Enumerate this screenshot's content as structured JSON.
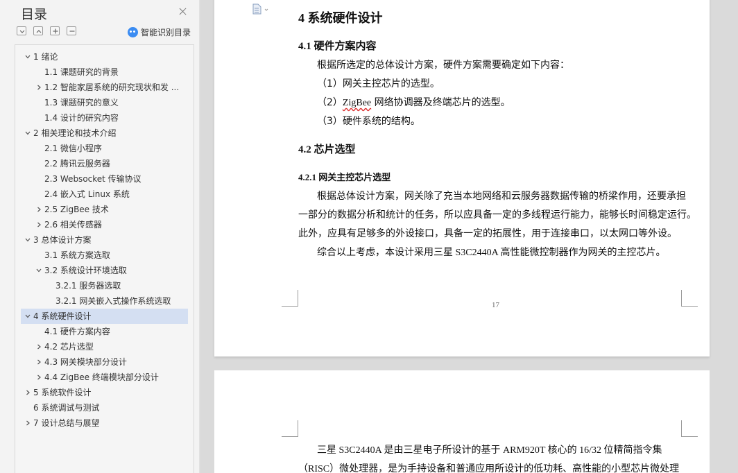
{
  "nav": {
    "title": "目录",
    "smart_toc_label": "智能识别目录",
    "items": [
      {
        "label": "1  绪论",
        "expandable": true,
        "expanded": true
      },
      {
        "label": "1.1  课题研究的背景",
        "expandable": false
      },
      {
        "label": "1.2  智能家居系统的研究现状和发 ...",
        "expandable": true,
        "expanded": false
      },
      {
        "label": "1.3  课题研究的意义",
        "expandable": false
      },
      {
        "label": "1.4  设计的研究内容",
        "expandable": false
      },
      {
        "label": "2  相关理论和技术介绍",
        "expandable": true,
        "expanded": true
      },
      {
        "label": "2.1  微信小程序",
        "expandable": false
      },
      {
        "label": "2.2  腾讯云服务器",
        "expandable": false
      },
      {
        "label": "2.3 Websocket 传输协议",
        "expandable": false
      },
      {
        "label": "2.4  嵌入式 Linux 系统",
        "expandable": false
      },
      {
        "label": "2.5 ZigBee 技术",
        "expandable": true,
        "expanded": false
      },
      {
        "label": "2.6  相关传感器",
        "expandable": true,
        "expanded": false
      },
      {
        "label": "3  总体设计方案",
        "expandable": true,
        "expanded": true
      },
      {
        "label": "3.1  系统方案选取",
        "expandable": false
      },
      {
        "label": "3.2  系统设计环境选取",
        "expandable": true,
        "expanded": true
      },
      {
        "label": "3.2.1  服务器选取",
        "expandable": false
      },
      {
        "label": "3.2.1  网关嵌入式操作系统选取",
        "expandable": false
      },
      {
        "label": "4  系统硬件设计",
        "expandable": true,
        "expanded": true,
        "active": true
      },
      {
        "label": "4.1  硬件方案内容",
        "expandable": false
      },
      {
        "label": "4.2  芯片选型",
        "expandable": true,
        "expanded": false
      },
      {
        "label": "4.3  网关模块部分设计",
        "expandable": true,
        "expanded": false
      },
      {
        "label": "4.4 ZigBee 终端模块部分设计",
        "expandable": true,
        "expanded": false
      },
      {
        "label": "5  系统软件设计",
        "expandable": true,
        "expanded": false
      },
      {
        "label": "6  系统调试与测试",
        "expandable": false
      },
      {
        "label": "7  设计总结与展望",
        "expandable": true,
        "expanded": false
      }
    ]
  },
  "document": {
    "chapter_title": "4  系统硬件设计",
    "sec_4_1_title": "4.1  硬件方案内容",
    "sec_4_1_intro": "根据所选定的总体设计方案，硬件方案需要确定如下内容：",
    "list_1": "（1）网关主控芯片的选型。",
    "list_2_prefix": "（2）",
    "list_2_zigbee": "ZigBee",
    "list_2_suffix": " 网络协调器及终端芯片的选型。",
    "list_3": "（3）硬件系统的结构。",
    "sec_4_2_title": "4.2  芯片选型",
    "sec_4_2_1_title": "4.2.1  网关主控芯片选型",
    "para_1_line_1": "根据总体设计方案，网关除了充当本地网络和云服务器数据传输的桥梁作用，还要承担",
    "para_1_line_2": "一部分的数据分析和统计的任务，所以应具备一定的多线程运行能力，能够长时间稳定运行。",
    "para_1_line_3": "此外，应具有足够多的外设接口，具备一定的拓展性，用于连接串口，以太网口等外设。",
    "para_2": "综合以上考虑，本设计采用三星 S3C2440A 高性能微控制器作为网关的主控芯片。",
    "page_number": "17",
    "page2_line_1": "三星  S3C2440A 是由三星电子所设计的基于  ARM920T 核心的 16/32 位精简指令集",
    "page2_line_2": "（RISC）微处理器，是为手持设备和普通应用所设计的低功耗、高性能的小型芯片微处理"
  }
}
